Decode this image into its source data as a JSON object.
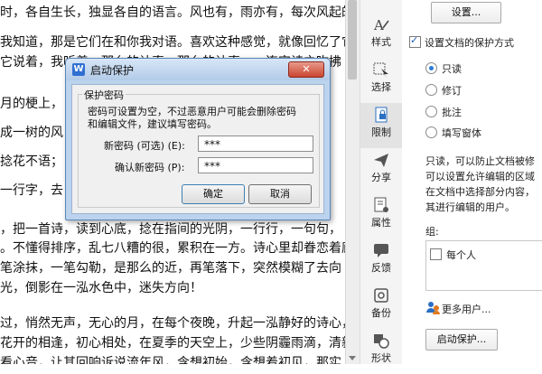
{
  "document": {
    "lines": [
      "时，各自生长，独显各自的语言。风也有，雨亦有，每次风起的",
      "我知道，那是它们在和你我对语。喜欢这种感觉，就像回忆了它",
      "它说着，我听着，那么的认真，那么的认真，一连实诗之吹拂",
      "",
      "月的梗上，",
      "成一树的风",
      "捻花不语；",
      "一行字，去",
      "，把一首诗，读到心底，捻在指间的光阴，一行行，一句句，",
      "。不懂得排序，乱七八糟的很，累积在一方。诗心里却眷恋着廊",
      "笔涂抹，一笔勾勒，是那么的近，再笔落下，突然模糊了去向",
      "光，倒影在一泓水色中，迷失方向！",
      "",
      "过，悄然无声，无心的月，在每个夜晚，升起一泓静好的诗心，",
      "花开的相逢，初心相处，在夏季的天空上，少些阴霾雨滴，清新",
      "看心音，让其回响诉说流年风，含想初始，含想着初见，那实"
    ]
  },
  "sidebar": {
    "items": [
      {
        "label": "样式",
        "icon": "style-icon"
      },
      {
        "label": "选择",
        "icon": "select-icon"
      },
      {
        "label": "限制",
        "icon": "restrict-icon"
      },
      {
        "label": "分享",
        "icon": "share-icon"
      },
      {
        "label": "属性",
        "icon": "properties-icon"
      },
      {
        "label": "反馈",
        "icon": "feedback-icon"
      },
      {
        "label": "备份",
        "icon": "backup-icon"
      },
      {
        "label": "形状",
        "icon": "shape-icon"
      }
    ]
  },
  "panel": {
    "settings_button": "设置...",
    "protect_checkbox_label": "设置文档的保护方式",
    "protect_checked": true,
    "modes": [
      {
        "label": "只读",
        "selected": true
      },
      {
        "label": "修订",
        "selected": false
      },
      {
        "label": "批注",
        "selected": false
      },
      {
        "label": "填写窗体",
        "selected": false
      }
    ],
    "description": [
      "只读，可以防止文档被修",
      "可以设置允许编辑的区域",
      "在文档中选择部分内容，",
      "其进行编辑的用户。"
    ],
    "group_label": "组:",
    "group_item": "每个人",
    "more_users": "更多用户...",
    "start_protect_button": "启动保护..."
  },
  "dialog": {
    "title": "启动保护",
    "close_symbol": "✕",
    "group_legend": "保护密码",
    "hint_line1": "密码可设置为空，不过恶意用户可能会删除密码",
    "hint_line2": "和编辑文件，建议填写密码。",
    "new_password_label": "新密码 (可选) (E):",
    "new_password_value": "***",
    "confirm_password_label": "确认新密码 (P):",
    "confirm_password_value": "***",
    "ok_button": "确定",
    "cancel_button": "取消"
  }
}
